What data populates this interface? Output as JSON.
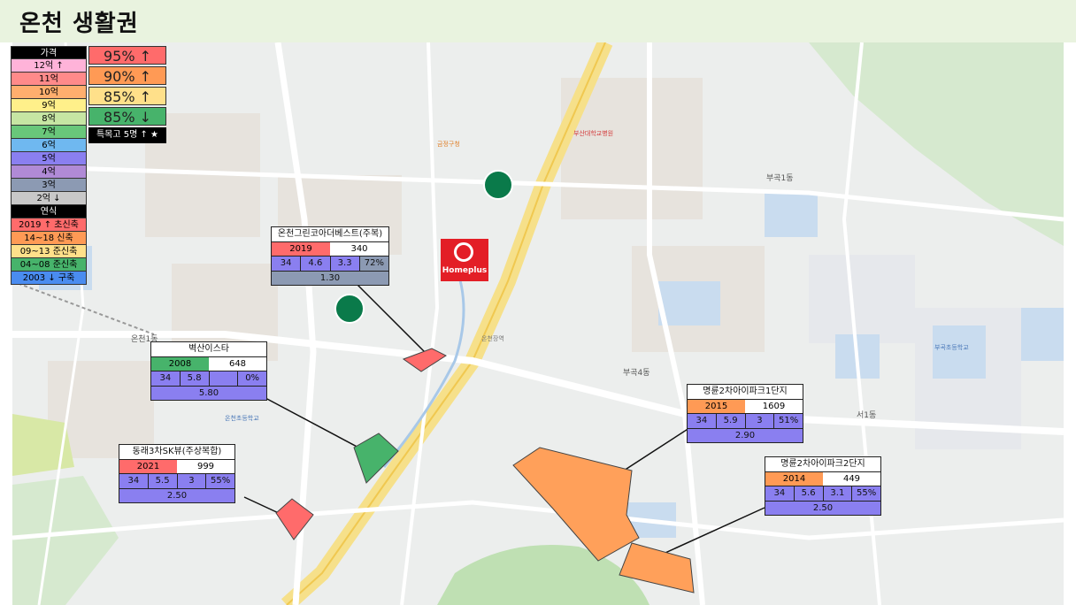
{
  "page": {
    "title": "온천 생활권"
  },
  "colors": {
    "price_12": "#ffb3d9",
    "price_11": "#ff8a8a",
    "price_10": "#ffae6e",
    "price_9": "#fff08a",
    "price_8": "#c6e6a3",
    "price_7": "#69c77a",
    "price_6": "#6fb8f0",
    "price_5": "#8a7ff0",
    "price_4": "#b08ad6",
    "price_3": "#8c9ab3",
    "price_2": "#c8c8c8",
    "era_2019": "#ff6b6b",
    "era_1418": "#ff9a55",
    "era_0913": "#ffe08a",
    "era_0408": "#47b36b",
    "era_2003": "#4a8cf0"
  },
  "legend": {
    "price_header": "가격",
    "price_items": [
      {
        "label": "12억 ↑",
        "color": "#ffb3d9"
      },
      {
        "label": "11억",
        "color": "#ff8a8a"
      },
      {
        "label": "10억",
        "color": "#ffae6e"
      },
      {
        "label": "9억",
        "color": "#fff08a"
      },
      {
        "label": "8억",
        "color": "#c6e6a3"
      },
      {
        "label": "7억",
        "color": "#69c77a"
      },
      {
        "label": "6억",
        "color": "#6fb8f0"
      },
      {
        "label": "5억",
        "color": "#8a7ff0"
      },
      {
        "label": "4억",
        "color": "#b08ad6"
      },
      {
        "label": "3억",
        "color": "#8c9ab3"
      },
      {
        "label": "2억 ↓",
        "color": "#c8c8c8"
      }
    ],
    "era_header": "연식",
    "era_items": [
      {
        "label": "2019 ↑ 초신축",
        "color": "#ff6b6b"
      },
      {
        "label": "14~18 신축",
        "color": "#ff9a55"
      },
      {
        "label": "09~13 준신축",
        "color": "#ffe08a"
      },
      {
        "label": "04~08 준신축",
        "color": "#47b36b"
      },
      {
        "label": "2003 ↓ 구축",
        "color": "#4a8cf0"
      }
    ]
  },
  "ratio_legend": {
    "items": [
      {
        "label": "95% ↑",
        "color": "#ff6b6b"
      },
      {
        "label": "90% ↑",
        "color": "#ff9a55"
      },
      {
        "label": "85% ↑",
        "color": "#ffe08a"
      },
      {
        "label": "85% ↓",
        "color": "#47b36b"
      }
    ],
    "special": "특목고 5명 ↑ ★"
  },
  "complexes": [
    {
      "name": "온천그린코아더베스트(주복)",
      "year": "2019",
      "units": "340",
      "area": "34",
      "v1": "4.6",
      "v2": "3.3",
      "ratio": "72%",
      "gap": "1.30"
    },
    {
      "name": "벽산이스타",
      "year": "2008",
      "units": "648",
      "area": "34",
      "v1": "5.8",
      "v2": "",
      "ratio": "0%",
      "gap": "5.80"
    },
    {
      "name": "동래3차SK뷰(주상복합)",
      "year": "2021",
      "units": "999",
      "area": "34",
      "v1": "5.5",
      "v2": "3",
      "ratio": "55%",
      "gap": "2.50"
    },
    {
      "name": "명륜2차아이파크1단지",
      "year": "2015",
      "units": "1609",
      "area": "34",
      "v1": "5.9",
      "v2": "3",
      "ratio": "51%",
      "gap": "2.90"
    },
    {
      "name": "명륜2차아이파크2단지",
      "year": "2014",
      "units": "449",
      "area": "34",
      "v1": "5.6",
      "v2": "3.1",
      "ratio": "55%",
      "gap": "2.50"
    }
  ],
  "map": {
    "homeplus_label": "Homeplus",
    "labels": {
      "oncheon1": "온천1동",
      "bugok1": "부곡1동",
      "bugok4": "부곡4동",
      "seo1": "서1동",
      "oncheon_station": "온천장역",
      "busan_univ_hospital": "부산대학교병원",
      "oncheon_elem": "온천초등학교",
      "bugok_elem": "부곡초등학교",
      "geumjeong_office": "금정구청"
    }
  }
}
